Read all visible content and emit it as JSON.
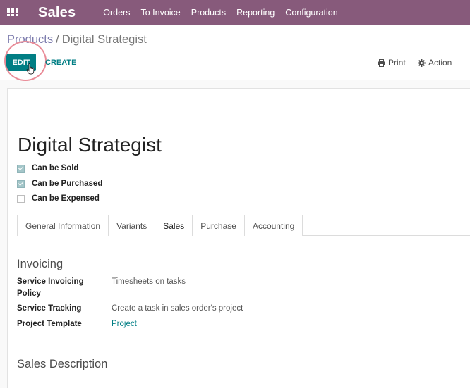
{
  "navbar": {
    "apps_icon": "apps-grid-icon",
    "brand": "Sales",
    "menu": [
      "Orders",
      "To Invoice",
      "Products",
      "Reporting",
      "Configuration"
    ]
  },
  "breadcrumb": {
    "parent": "Products",
    "separator": "/",
    "current": "Digital Strategist"
  },
  "toolbar": {
    "edit_label": "EDIT",
    "create_label": "CREATE",
    "print_label": "Print",
    "print_icon": "print-icon",
    "action_label": "Action",
    "action_icon": "gear-icon"
  },
  "product": {
    "name": "Digital Strategist",
    "checkboxes": [
      {
        "label": "Can be Sold",
        "checked": true
      },
      {
        "label": "Can be Purchased",
        "checked": true
      },
      {
        "label": "Can be Expensed",
        "checked": false
      }
    ]
  },
  "tabs": {
    "items": [
      "General Information",
      "Variants",
      "Sales",
      "Purchase",
      "Accounting"
    ],
    "active": "Sales"
  },
  "invoicing": {
    "title": "Invoicing",
    "fields": [
      {
        "label": "Service Invoicing Policy",
        "value": "Timesheets on tasks"
      },
      {
        "label": "Service Tracking",
        "value": "Create a task in sales order's project"
      },
      {
        "label": "Project Template",
        "value": "Project"
      }
    ]
  },
  "sales_description": {
    "title": "Sales Description"
  },
  "colors": {
    "navbar": "#875a7b",
    "primary_button": "#017e84",
    "checkbox_checked": "#a4c6c9",
    "highlight_ring": "#e98b97"
  }
}
